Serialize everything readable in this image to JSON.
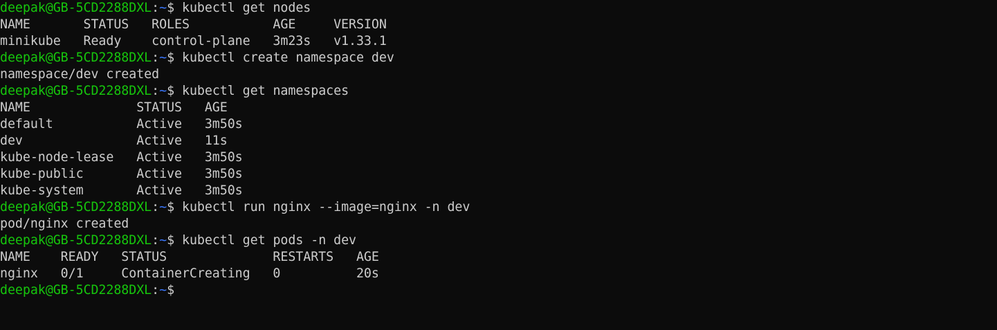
{
  "colors": {
    "background": "#0c0c0c",
    "foreground": "#cccccc",
    "prompt_user": "#16c60c",
    "prompt_path": "#3b78ff"
  },
  "lines": [
    {
      "type": "prompt",
      "user": "deepak@GB-5CD2288DXL",
      "colon": ":",
      "path": "~",
      "dollar": "$ ",
      "cmd": "kubectl get nodes"
    },
    {
      "type": "output",
      "text": "NAME       STATUS   ROLES           AGE     VERSION"
    },
    {
      "type": "output",
      "text": "minikube   Ready    control-plane   3m23s   v1.33.1"
    },
    {
      "type": "prompt",
      "user": "deepak@GB-5CD2288DXL",
      "colon": ":",
      "path": "~",
      "dollar": "$ ",
      "cmd": "kubectl create namespace dev"
    },
    {
      "type": "output",
      "text": "namespace/dev created"
    },
    {
      "type": "prompt",
      "user": "deepak@GB-5CD2288DXL",
      "colon": ":",
      "path": "~",
      "dollar": "$ ",
      "cmd": "kubectl get namespaces"
    },
    {
      "type": "output",
      "text": "NAME              STATUS   AGE"
    },
    {
      "type": "output",
      "text": "default           Active   3m50s"
    },
    {
      "type": "output",
      "text": "dev               Active   11s"
    },
    {
      "type": "output",
      "text": "kube-node-lease   Active   3m50s"
    },
    {
      "type": "output",
      "text": "kube-public       Active   3m50s"
    },
    {
      "type": "output",
      "text": "kube-system       Active   3m50s"
    },
    {
      "type": "prompt",
      "user": "deepak@GB-5CD2288DXL",
      "colon": ":",
      "path": "~",
      "dollar": "$ ",
      "cmd": "kubectl run nginx --image=nginx -n dev"
    },
    {
      "type": "output",
      "text": "pod/nginx created"
    },
    {
      "type": "prompt",
      "user": "deepak@GB-5CD2288DXL",
      "colon": ":",
      "path": "~",
      "dollar": "$ ",
      "cmd": "kubectl get pods -n dev"
    },
    {
      "type": "output",
      "text": "NAME    READY   STATUS              RESTARTS   AGE"
    },
    {
      "type": "output",
      "text": "nginx   0/1     ContainerCreating   0          20s"
    },
    {
      "type": "prompt",
      "user": "deepak@GB-5CD2288DXL",
      "colon": ":",
      "path": "~",
      "dollar": "$",
      "cmd": ""
    }
  ]
}
